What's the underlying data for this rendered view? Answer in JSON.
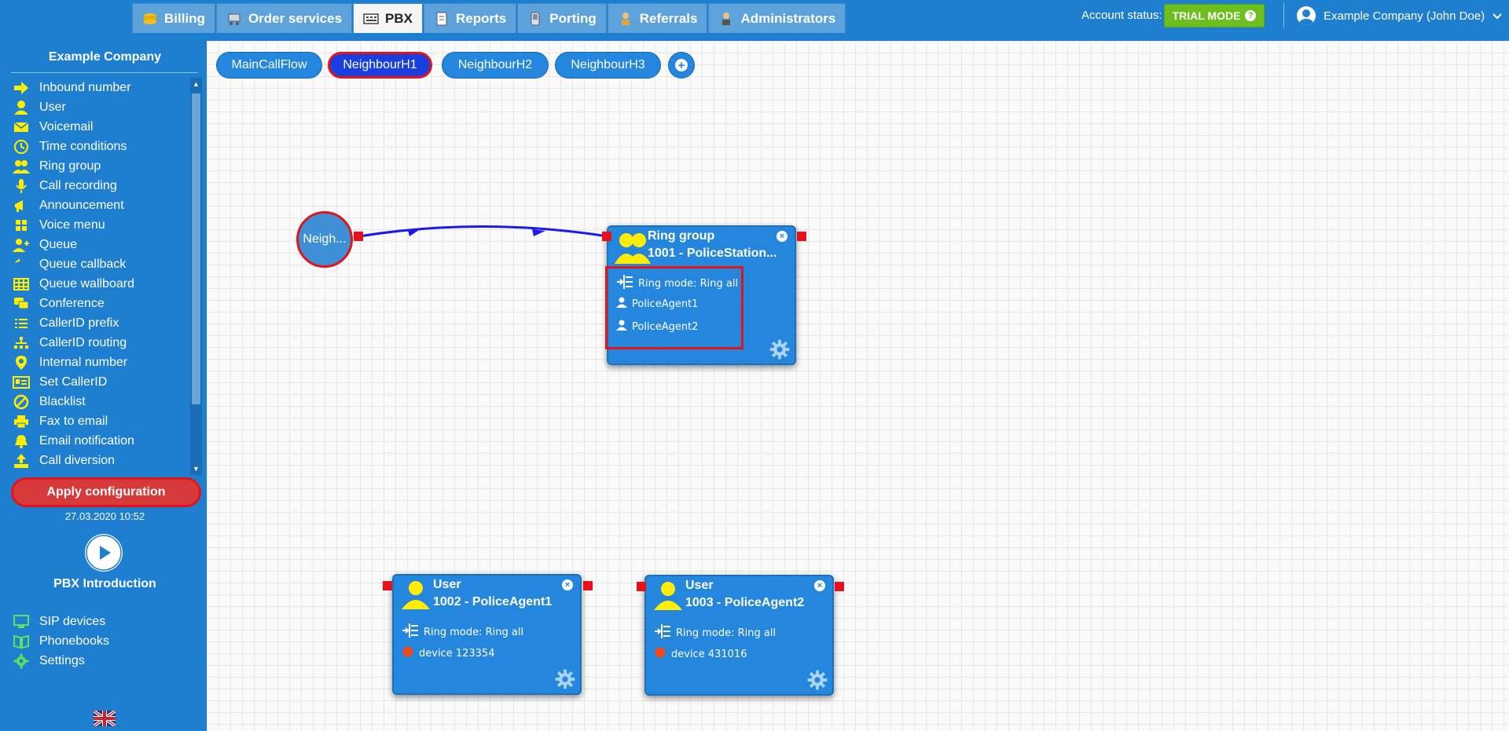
{
  "tabs": [
    {
      "label": "Billing",
      "icon": "coins-icon"
    },
    {
      "label": "Order services",
      "icon": "cart-icon"
    },
    {
      "label": "PBX",
      "icon": "pbx-icon",
      "active": true
    },
    {
      "label": "Reports",
      "icon": "report-icon"
    },
    {
      "label": "Porting",
      "icon": "phone-icon"
    },
    {
      "label": "Referrals",
      "icon": "referral-icon"
    },
    {
      "label": "Administrators",
      "icon": "admin-icon"
    }
  ],
  "account": {
    "status_label": "Account status:",
    "status_badge": "TRIAL MODE",
    "user_name": "Example Company (John Doe)"
  },
  "sidebar": {
    "company": "Example Company",
    "items": [
      {
        "label": "Inbound number",
        "icon": "arrow-right-icon"
      },
      {
        "label": "User",
        "icon": "user-icon"
      },
      {
        "label": "Voicemail",
        "icon": "envelope-icon"
      },
      {
        "label": "Time conditions",
        "icon": "clock-icon"
      },
      {
        "label": "Ring group",
        "icon": "group-icon"
      },
      {
        "label": "Call recording",
        "icon": "microphone-icon"
      },
      {
        "label": "Announcement",
        "icon": "megaphone-icon"
      },
      {
        "label": "Voice menu",
        "icon": "grid-icon"
      },
      {
        "label": "Queue",
        "icon": "user-plus-icon"
      },
      {
        "label": "Queue callback",
        "icon": "reply-icon"
      },
      {
        "label": "Queue wallboard",
        "icon": "table-icon"
      },
      {
        "label": "Conference",
        "icon": "chat-icon"
      },
      {
        "label": "CallerID prefix",
        "icon": "list-icon"
      },
      {
        "label": "CallerID routing",
        "icon": "sitemap-icon"
      },
      {
        "label": "Internal number",
        "icon": "map-pin-icon"
      },
      {
        "label": "Set CallerID",
        "icon": "id-card-icon"
      },
      {
        "label": "Blacklist",
        "icon": "ban-icon"
      },
      {
        "label": "Fax to email",
        "icon": "printer-icon"
      },
      {
        "label": "Email notification",
        "icon": "bell-icon"
      },
      {
        "label": "Call diversion",
        "icon": "upload-icon"
      }
    ],
    "apply_label": "Apply configuration",
    "date": "27.03.2020 10:52",
    "intro_label": "PBX Introduction",
    "bottom_items": [
      {
        "label": "SIP devices",
        "icon": "monitor-icon"
      },
      {
        "label": "Phonebooks",
        "icon": "book-icon"
      },
      {
        "label": "Settings",
        "icon": "gear-icon"
      }
    ]
  },
  "flow_tabs": [
    {
      "label": "MainCallFlow"
    },
    {
      "label": "NeighbourH1",
      "active": true
    },
    {
      "label": "NeighbourH2"
    },
    {
      "label": "NeighbourH3"
    }
  ],
  "start_node": {
    "label": "Neigh..."
  },
  "nodes": {
    "ring_group": {
      "title": "Ring group",
      "subtitle": "1001 - PoliceStation...",
      "ring_mode": "Ring mode: Ring all",
      "members": [
        "PoliceAgent1",
        "PoliceAgent2"
      ]
    },
    "user1": {
      "title": "User",
      "subtitle": "1002 - PoliceAgent1",
      "ring_mode": "Ring mode: Ring all",
      "device": "device 123354"
    },
    "user2": {
      "title": "User",
      "subtitle": "1003 - PoliceAgent2",
      "ring_mode": "Ring mode: Ring all",
      "device": "device 431016"
    }
  },
  "colors": {
    "accent": "#1e7fd0",
    "node": "#2486dc",
    "highlight": "#e2141a",
    "icon": "#ffee00",
    "trial": "#6cbf1d"
  }
}
